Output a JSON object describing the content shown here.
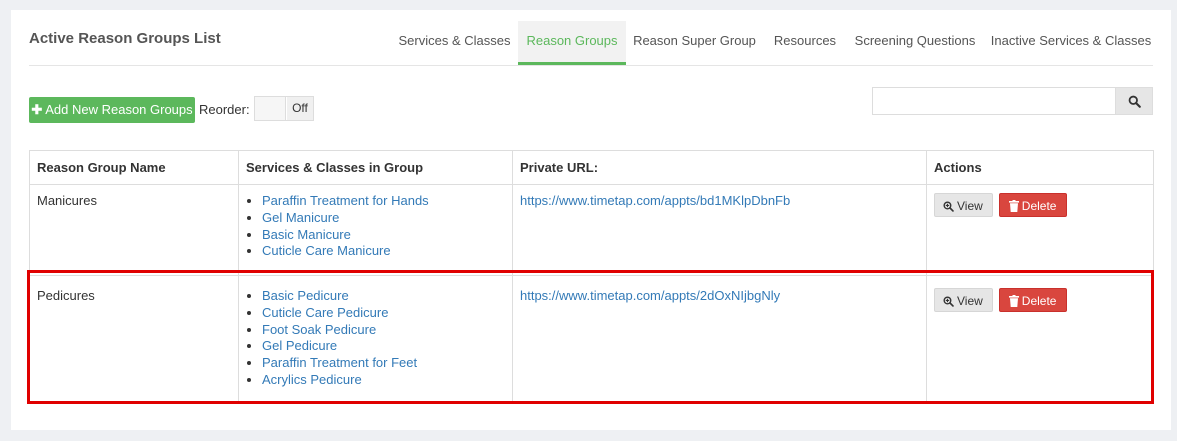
{
  "page": {
    "title": "Active Reason Groups List"
  },
  "tabs": [
    {
      "label": "Services & Classes",
      "active": false
    },
    {
      "label": "Reason Groups",
      "active": true
    },
    {
      "label": "Reason Super Group",
      "active": false
    },
    {
      "label": "Resources",
      "active": false
    },
    {
      "label": "Screening Questions",
      "active": false
    },
    {
      "label": "Inactive Services & Classes",
      "active": false
    }
  ],
  "toolbar": {
    "add_label": "Add New Reason Groups",
    "add_icon": "plus-icon",
    "reorder_label": "Reorder:",
    "reorder_state": "Off",
    "search_value": "",
    "search_icon": "search-icon"
  },
  "table": {
    "headers": [
      "Reason Group Name",
      "Services & Classes in Group",
      "Private URL:",
      "Actions"
    ],
    "rows": [
      {
        "name": "Manicures",
        "services": [
          "Paraffin Treatment for Hands",
          "Gel Manicure",
          "Basic Manicure",
          "Cuticle Care Manicure"
        ],
        "url": "https://www.timetap.com/appts/bd1MKlpDbnFb",
        "view_label": "View",
        "delete_label": "Delete"
      },
      {
        "name": "Pedicures",
        "services": [
          "Basic Pedicure",
          "Cuticle Care Pedicure",
          "Foot Soak Pedicure",
          "Gel Pedicure",
          "Paraffin Treatment for Feet",
          "Acrylics Pedicure"
        ],
        "url": "https://www.timetap.com/appts/2dOxNIjbgNly",
        "view_label": "View",
        "delete_label": "Delete"
      }
    ]
  },
  "colors": {
    "accent": "#5cb85c",
    "link": "#337ab7",
    "danger": "#d9463e",
    "highlight": "#e00000"
  }
}
